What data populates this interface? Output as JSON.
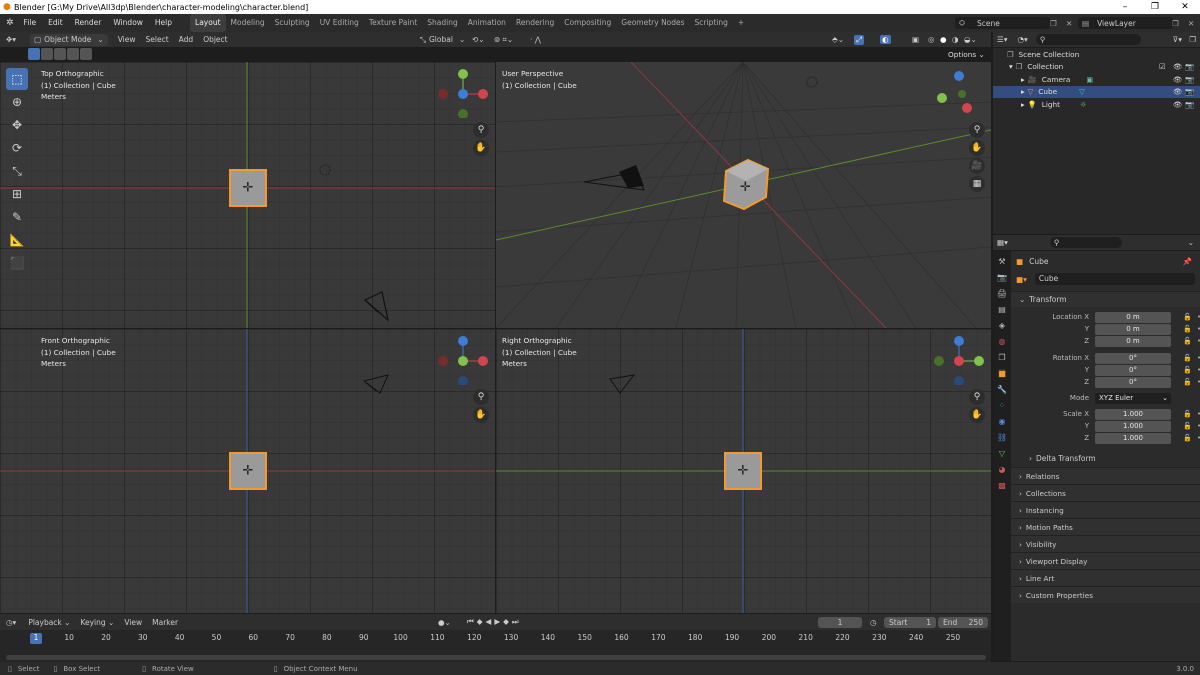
{
  "window": {
    "title": "Blender [G:\\My Drive\\All3dp\\Blender\\character-modeling\\character.blend]",
    "min": "–",
    "max": "❐",
    "close": "✕"
  },
  "menu": [
    "File",
    "Edit",
    "Render",
    "Window",
    "Help"
  ],
  "workspaces": [
    "Layout",
    "Modeling",
    "Sculpting",
    "UV Editing",
    "Texture Paint",
    "Shading",
    "Animation",
    "Rendering",
    "Compositing",
    "Geometry Nodes",
    "Scripting",
    "+"
  ],
  "scene": {
    "name": "Scene",
    "viewlayer": "ViewLayer"
  },
  "viewport_header": {
    "mode": "Object Mode",
    "menus": [
      "View",
      "Select",
      "Add",
      "Object"
    ],
    "orientation": "Global",
    "options": "Options"
  },
  "viewports": [
    {
      "title": "Top Orthographic",
      "collection": "(1) Collection | Cube",
      "units": "Meters"
    },
    {
      "title": "User Perspective",
      "collection": "(1) Collection | Cube",
      "units": ""
    },
    {
      "title": "Front Orthographic",
      "collection": "(1) Collection | Cube",
      "units": "Meters"
    },
    {
      "title": "Right Orthographic",
      "collection": "(1) Collection | Cube",
      "units": "Meters"
    }
  ],
  "outliner": {
    "root": "Scene Collection",
    "collection": "Collection",
    "items": [
      {
        "name": "Camera",
        "selected": false,
        "color": "#d9823a"
      },
      {
        "name": "Cube",
        "selected": true,
        "color": "#e89a5c"
      },
      {
        "name": "Light",
        "selected": false,
        "color": "#e8a050"
      }
    ]
  },
  "properties": {
    "object_name": "Cube",
    "data_name": "Cube",
    "transform_label": "Transform",
    "location": {
      "label": "Location X",
      "values": [
        "0 m",
        "0 m",
        "0 m"
      ]
    },
    "rotation": {
      "label": "Rotation X",
      "values": [
        "0°",
        "0°",
        "0°"
      ]
    },
    "mode": {
      "label": "Mode",
      "value": "XYZ Euler"
    },
    "scale": {
      "label": "Scale X",
      "values": [
        "1.000",
        "1.000",
        "1.000"
      ]
    },
    "axis_y": "Y",
    "axis_z": "Z",
    "delta": "Delta Transform",
    "panels": [
      "Relations",
      "Collections",
      "Instancing",
      "Motion Paths",
      "Visibility",
      "Viewport Display",
      "Line Art",
      "Custom Properties"
    ]
  },
  "timeline": {
    "menus": [
      "Playback",
      "Keying",
      "View",
      "Marker"
    ],
    "current": "1",
    "start_label": "Start",
    "start": "1",
    "end_label": "End",
    "end": "250",
    "ticks": [
      "1",
      "10",
      "20",
      "30",
      "40",
      "50",
      "60",
      "70",
      "80",
      "90",
      "100",
      "110",
      "120",
      "130",
      "140",
      "150",
      "160",
      "170",
      "180",
      "190",
      "200",
      "210",
      "220",
      "230",
      "240",
      "250"
    ]
  },
  "statusbar": {
    "select": "Select",
    "box_select": "Box Select",
    "rotate": "Rotate View",
    "context": "Object Context Menu",
    "version": "3.0.0"
  },
  "colors": {
    "accent": "#4772b3",
    "selection": "#f59a2a",
    "x_axis": "#d2454f",
    "y_axis": "#80c24c",
    "z_axis": "#3e7dd6"
  }
}
